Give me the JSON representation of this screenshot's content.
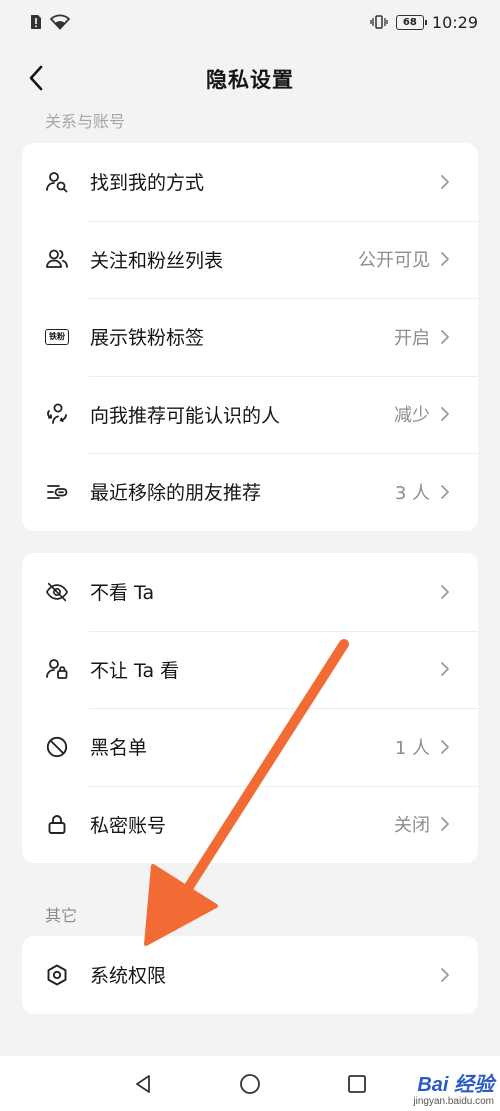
{
  "status_bar": {
    "time": "10:29",
    "battery": "68"
  },
  "header": {
    "title": "隐私设置"
  },
  "section_relations": {
    "label": "关系与账号"
  },
  "group1": [
    {
      "label": "找到我的方式",
      "value": "",
      "icon": "find-person-icon"
    },
    {
      "label": "关注和粉丝列表",
      "value": "公开可见",
      "icon": "users-icon"
    },
    {
      "label": "展示铁粉标签",
      "value": "开启",
      "icon": "fan-badge-icon",
      "badge_text": "铁粉"
    },
    {
      "label": "向我推荐可能认识的人",
      "value": "减少",
      "icon": "recommend-person-icon"
    },
    {
      "label": "最近移除的朋友推荐",
      "value": "3 人",
      "icon": "removed-list-icon"
    }
  ],
  "group2": [
    {
      "label": "不看 Ta",
      "value": "",
      "icon": "eye-off-icon"
    },
    {
      "label": "不让 Ta 看",
      "value": "",
      "icon": "person-lock-icon"
    },
    {
      "label": "黑名单",
      "value": "1 人",
      "icon": "block-icon"
    },
    {
      "label": "私密账号",
      "value": "关闭",
      "icon": "lock-icon"
    }
  ],
  "section_other": {
    "label": "其它"
  },
  "group3": [
    {
      "label": "系统权限",
      "value": "",
      "icon": "hexagon-settings-icon"
    }
  ],
  "annotation": {
    "arrow_color": "#f26b35"
  },
  "watermark": {
    "brand": "Bai 经验",
    "site": "jingyan.baidu.com"
  }
}
